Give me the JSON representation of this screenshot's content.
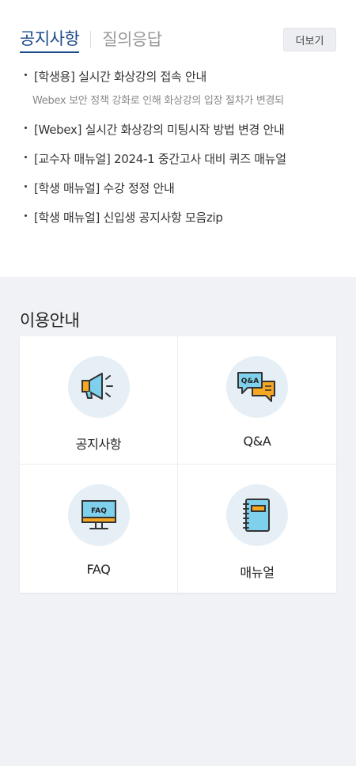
{
  "notice": {
    "tabs": [
      {
        "label": "공지사항",
        "active": true
      },
      {
        "label": "질의응답",
        "active": false
      }
    ],
    "more_label": "더보기",
    "items": [
      {
        "title": "[학생용] 실시간 화상강의 접속 안내",
        "desc": "Webex 보안 정책 강화로 인해 화상강의 입장 절차가 변경되"
      },
      {
        "title": "[Webex] 실시간 화상강의 미팅시작 방법 변경 안내"
      },
      {
        "title": "[교수자 매뉴얼] 2024-1 중간고사 대비 퀴즈 매뉴얼"
      },
      {
        "title": "[학생 매뉴얼] 수강 정정 안내"
      },
      {
        "title": "[학생 매뉴얼] 신입생 공지사항 모음zip"
      }
    ]
  },
  "guide": {
    "title": "이용안내",
    "items": [
      {
        "label": "공지사항",
        "icon": "megaphone-icon"
      },
      {
        "label": "Q&A",
        "icon": "qa-bubbles-icon"
      },
      {
        "label": "FAQ",
        "icon": "faq-monitor-icon"
      },
      {
        "label": "매뉴얼",
        "icon": "manual-book-icon"
      }
    ]
  },
  "colors": {
    "accent": "#1c4a8a",
    "icon_circle": "#e6eff5",
    "icon_orange": "#f5a623",
    "icon_blue": "#7fd0ec"
  }
}
